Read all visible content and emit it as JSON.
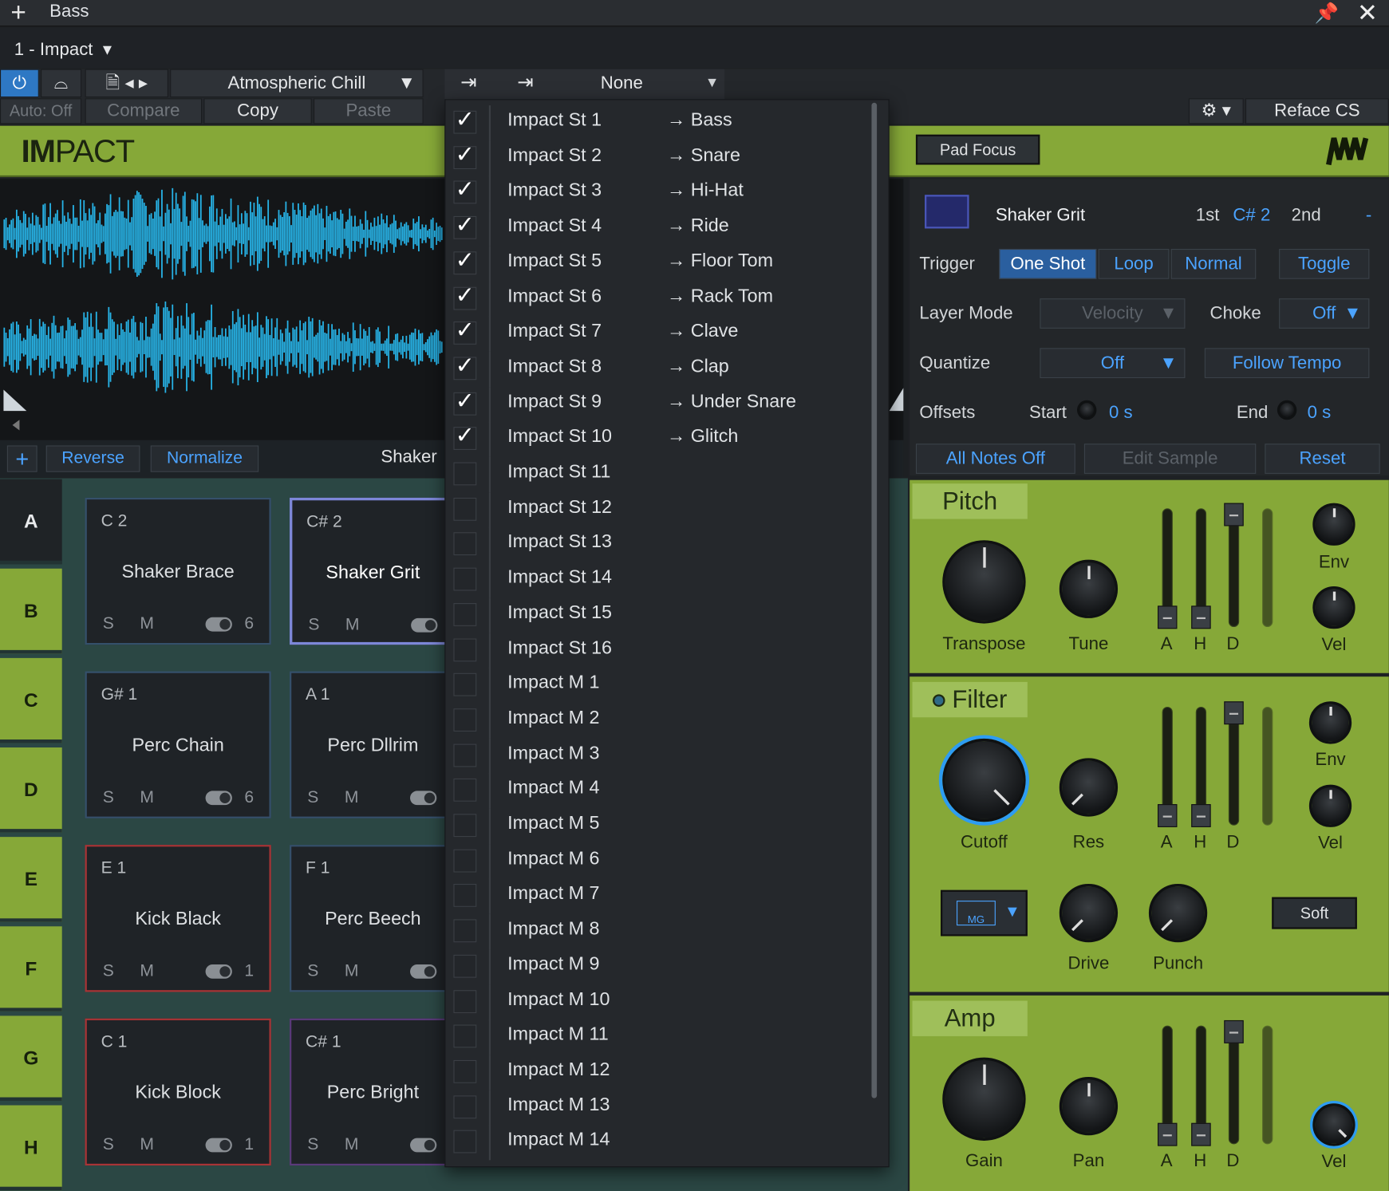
{
  "window": {
    "title": "Bass",
    "instrument": "1 - Impact"
  },
  "toolbar": {
    "preset": "Atmospheric Chill",
    "auto": "Auto: Off",
    "compare": "Compare",
    "copy": "Copy",
    "paste": "Paste",
    "device": "Reface CS"
  },
  "routing": {
    "selected": "None"
  },
  "header": {
    "logo_bold": "IM",
    "logo_rest": "PACT",
    "pad_focus": "Pad Focus"
  },
  "wave_tools": {
    "reverse": "Reverse",
    "normalize": "Normalize",
    "sample_name": "Shaker"
  },
  "banks": [
    "A",
    "B",
    "C",
    "D",
    "E",
    "F",
    "G",
    "H"
  ],
  "pads": [
    {
      "note": "C 2",
      "name": "Shaker Brace",
      "num": "6"
    },
    {
      "note": "C# 2",
      "name": "Shaker Grit",
      "num": ""
    },
    {
      "note": "G# 1",
      "name": "Perc Chain",
      "num": "6"
    },
    {
      "note": "A 1",
      "name": "Perc Dllrim",
      "num": ""
    },
    {
      "note": "E 1",
      "name": "Kick Black",
      "num": "1"
    },
    {
      "note": "F 1",
      "name": "Perc Beech",
      "num": ""
    },
    {
      "note": "C 1",
      "name": "Kick Block",
      "num": "1"
    },
    {
      "note": "C# 1",
      "name": "Perc Bright",
      "num": ""
    }
  ],
  "pad_sm": "S M",
  "outputs": [
    {
      "name": "Impact St 1",
      "dest": "→ Bass",
      "checked": true
    },
    {
      "name": "Impact St 2",
      "dest": "→ Snare",
      "checked": true
    },
    {
      "name": "Impact St 3",
      "dest": "→ Hi-Hat",
      "checked": true
    },
    {
      "name": "Impact St 4",
      "dest": "→ Ride",
      "checked": true
    },
    {
      "name": "Impact St 5",
      "dest": "→ Floor Tom",
      "checked": true
    },
    {
      "name": "Impact St 6",
      "dest": "→ Rack Tom",
      "checked": true
    },
    {
      "name": "Impact St 7",
      "dest": "→ Clave",
      "checked": true
    },
    {
      "name": "Impact St 8",
      "dest": "→ Clap",
      "checked": true
    },
    {
      "name": "Impact St 9",
      "dest": "→ Under Snare",
      "checked": true
    },
    {
      "name": "Impact St 10",
      "dest": "→ Glitch",
      "checked": true
    },
    {
      "name": "Impact St 11",
      "dest": "",
      "checked": false
    },
    {
      "name": "Impact St 12",
      "dest": "",
      "checked": false
    },
    {
      "name": "Impact St 13",
      "dest": "",
      "checked": false
    },
    {
      "name": "Impact St 14",
      "dest": "",
      "checked": false
    },
    {
      "name": "Impact St 15",
      "dest": "",
      "checked": false
    },
    {
      "name": "Impact St 16",
      "dest": "",
      "checked": false
    },
    {
      "name": "Impact M 1",
      "dest": "",
      "checked": false
    },
    {
      "name": "Impact M 2",
      "dest": "",
      "checked": false
    },
    {
      "name": "Impact M 3",
      "dest": "",
      "checked": false
    },
    {
      "name": "Impact M 4",
      "dest": "",
      "checked": false
    },
    {
      "name": "Impact M 5",
      "dest": "",
      "checked": false
    },
    {
      "name": "Impact M 6",
      "dest": "",
      "checked": false
    },
    {
      "name": "Impact M 7",
      "dest": "",
      "checked": false
    },
    {
      "name": "Impact M 8",
      "dest": "",
      "checked": false
    },
    {
      "name": "Impact M 9",
      "dest": "",
      "checked": false
    },
    {
      "name": "Impact M 10",
      "dest": "",
      "checked": false
    },
    {
      "name": "Impact M 11",
      "dest": "",
      "checked": false
    },
    {
      "name": "Impact M 12",
      "dest": "",
      "checked": false
    },
    {
      "name": "Impact M 13",
      "dest": "",
      "checked": false
    },
    {
      "name": "Impact M 14",
      "dest": "",
      "checked": false
    }
  ],
  "pad_panel": {
    "name": "Shaker Grit",
    "first": "1st",
    "first_note": "C# 2",
    "second": "2nd",
    "second_note": "-",
    "trigger": "Trigger",
    "one_shot": "One Shot",
    "loop": "Loop",
    "normal": "Normal",
    "toggle": "Toggle",
    "layer_mode": "Layer Mode",
    "velocity": "Velocity",
    "choke": "Choke",
    "choke_val": "Off",
    "quantize": "Quantize",
    "quantize_val": "Off",
    "follow_tempo": "Follow Tempo",
    "offsets": "Offsets",
    "start": "Start",
    "start_val": "0 s",
    "end": "End",
    "end_val": "0 s",
    "all_notes_off": "All Notes Off",
    "edit_sample": "Edit Sample",
    "reset": "Reset"
  },
  "pitch": {
    "title": "Pitch",
    "transpose": "Transpose",
    "tune": "Tune",
    "env": "Env",
    "vel": "Vel",
    "a": "A",
    "h": "H",
    "d": "D"
  },
  "filter": {
    "title": "Filter",
    "cutoff": "Cutoff",
    "res": "Res",
    "drive": "Drive",
    "punch": "Punch",
    "env": "Env",
    "vel": "Vel",
    "type": "MG",
    "soft": "Soft",
    "a": "A",
    "h": "H",
    "d": "D"
  },
  "amp": {
    "title": "Amp",
    "gain": "Gain",
    "pan": "Pan",
    "vel": "Vel",
    "a": "A",
    "h": "H",
    "d": "D"
  },
  "colors": {
    "accent": "#4ba3ff",
    "green": "#86a838",
    "pad_area": "#2b4744"
  }
}
